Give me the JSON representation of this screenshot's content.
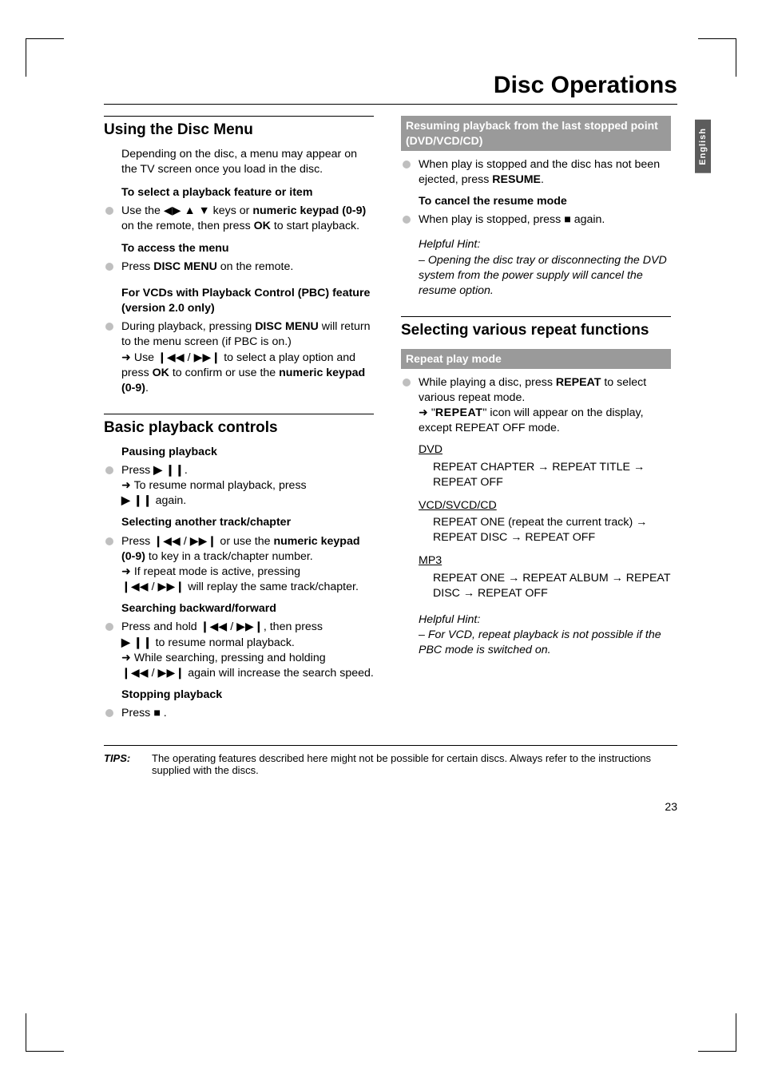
{
  "page_title": "Disc Operations",
  "side_tab": "English",
  "left": {
    "h1": "Using the Disc Menu",
    "p1": "Depending on the disc, a menu may appear on the TV screen once you load in the disc.",
    "sub1": "To select a playback feature or item",
    "b1a": "Use the ",
    "b1b": " keys or ",
    "b1c": "numeric keypad (0-9)",
    "b1d": " on the remote, then press ",
    "b1e": "OK",
    "b1f": " to start playback.",
    "sub2": "To access the menu",
    "b2a": "Press ",
    "b2b": "DISC MENU",
    "b2c": " on the remote.",
    "sub3": "For VCDs with Playback Control (PBC) feature (version 2.0 only)",
    "b3a": "During playback, pressing ",
    "b3b": "DISC MENU",
    "b3c": " will return to the menu screen (if PBC is on.)",
    "b3d": "Use ",
    "b3e": " to select a play option and press ",
    "b3f": "OK",
    "b3g": " to confirm or use the ",
    "b3h": "numeric keypad (0-9)",
    "b3i": ".",
    "h2": "Basic playback controls",
    "sub4": "Pausing playback",
    "b4a": "Press ",
    "b4b": ".",
    "b4c": "To resume normal playback, press ",
    "b4d": " again.",
    "sub5": "Selecting another track/chapter",
    "b5a": "Press ",
    "b5b": " or use the ",
    "b5c": "numeric keypad (0-9)",
    "b5d": " to key in a track/chapter number.",
    "b5e": "If repeat mode is active, pressing ",
    "b5f": " will replay the same track/chapter.",
    "sub6": "Searching backward/forward",
    "b6a": "Press and hold ",
    "b6b": ", then press ",
    "b6c": " to resume normal playback.",
    "b6d": "While searching, pressing and holding ",
    "b6e": " again will increase the search speed.",
    "sub7": "Stopping playback",
    "b7a": "Press ",
    "b7b": "."
  },
  "right": {
    "sh1": "Resuming playback from the last stopped point (DVD/VCD/CD)",
    "b1a": "When play is stopped and the disc has not been ejected, press ",
    "b1b": "RESUME",
    "b1c": ".",
    "sub1": "To cancel the resume mode",
    "b2a": "When play is stopped, press ",
    "b2b": " again.",
    "hint1_label": "Helpful Hint:",
    "hint1": "– Opening the disc tray or disconnecting the DVD system from the power supply will cancel the resume option.",
    "h1": "Selecting various repeat functions",
    "sh2": "Repeat play mode",
    "b3a": "While playing a disc, press ",
    "b3b": "REPEAT",
    "b3c": " to select various repeat mode.",
    "b3d": "\"",
    "b3e": "REPEAT",
    "b3f": "\" icon will appear on the display, except REPEAT OFF mode.",
    "dvd": "DVD",
    "dvd1": "REPEAT CHAPTER → REPEAT  TITLE → REPEAT OFF",
    "vcd": "VCD/SVCD/CD",
    "vcd1": "REPEAT ONE (repeat the current track) → REPEAT DISC → REPEAT OFF",
    "mp3": "MP3",
    "mp31": "REPEAT ONE → REPEAT ALBUM → REPEAT DISC → REPEAT OFF",
    "hint2_label": "Helpful Hint:",
    "hint2": "– For VCD, repeat playback is not possible if the PBC mode is switched on."
  },
  "tips_label": "TIPS:",
  "tips_text": "The operating features described here might not be possible for certain discs.  Always refer to the instructions supplied with the discs.",
  "page_number": "23",
  "glyphs": {
    "left": "◀",
    "right": "▶",
    "up": "▲",
    "down": "▼",
    "playpause": "▶ ❙❙",
    "prev": "❙◀◀",
    "next": "▶▶❙",
    "stop": "■",
    "arrow": "➜"
  }
}
